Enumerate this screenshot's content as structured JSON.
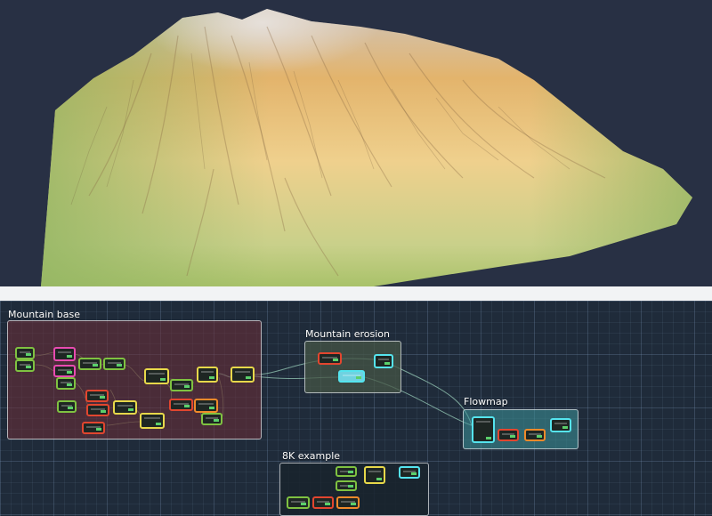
{
  "app": {
    "accent": "#4fd0d8"
  },
  "graph": {
    "groups": [
      {
        "id": "mountain-base",
        "title": "Mountain base",
        "fill": "#5a2a33"
      },
      {
        "id": "mountain-erosion",
        "title": "Mountain erosion",
        "fill": "#3f4a3a"
      },
      {
        "id": "flowmap",
        "title": "Flowmap",
        "fill": "#2e6a6e"
      },
      {
        "id": "8k-example",
        "title": "8K example",
        "fill": "#1c2530"
      }
    ]
  },
  "colors": {
    "node_green": "#7fc241",
    "node_yellow": "#e7d84a",
    "node_pink": "#e84bb0",
    "node_red": "#e2462f",
    "node_orange": "#f08a2a",
    "node_cyan": "#55e4ee",
    "terrain_peak": "#d9cbb7",
    "terrain_mid": "#e8b56a",
    "terrain_low": "#9fbf6a"
  }
}
